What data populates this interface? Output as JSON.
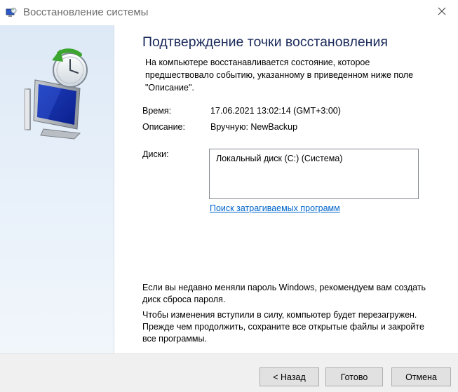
{
  "window": {
    "title": "Восстановление системы",
    "app_icon": "system-restore-icon",
    "close_icon": "close-icon"
  },
  "sidebar": {
    "icon": "system-restore-wizard-icon"
  },
  "main": {
    "heading": "Подтверждение точки восстановления",
    "description": "На компьютере восстанавливается состояние, которое предшествовало событию, указанному в приведенном ниже поле \"Описание\".",
    "time_label": "Время:",
    "time_value": "17.06.2021 13:02:14 (GMT+3:00)",
    "description_label": "Описание:",
    "description_value": "Вручную: NewBackup",
    "drives_label": "Диски:",
    "drives": [
      "Локальный диск (C:) (Система)"
    ],
    "scan_link": "Поиск затрагиваемых программ",
    "password_note": "Если вы недавно меняли пароль Windows, рекомендуем вам создать диск сброса пароля.",
    "restart_note": "Чтобы изменения вступили в силу, компьютер будет перезагружен. Прежде чем продолжить, сохраните все открытые файлы и закройте все программы."
  },
  "buttons": {
    "back": "< Назад",
    "finish": "Готово",
    "cancel": "Отмена"
  },
  "colors": {
    "heading": "#1a2a5a",
    "link": "#0066cc",
    "sidebar": "#dde9f6",
    "footer": "#f0f0f0"
  }
}
